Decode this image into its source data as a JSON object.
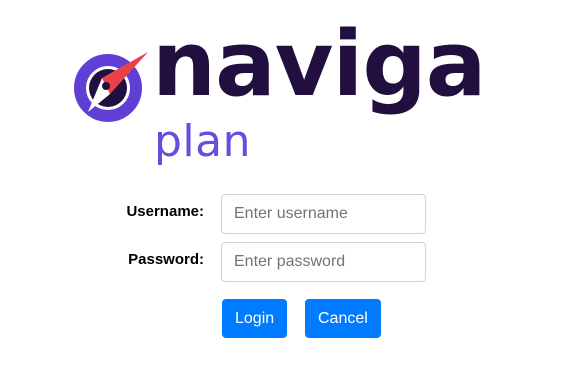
{
  "brand": {
    "name": "naviga",
    "product": "plan",
    "colors": {
      "dark": "#21103f",
      "purple": "#6a4be0",
      "red": "#e9404a",
      "ring": "#5f3fd6"
    },
    "icon": "compass-icon"
  },
  "form": {
    "username": {
      "label": "Username:",
      "placeholder": "Enter username",
      "value": ""
    },
    "password": {
      "label": "Password:",
      "placeholder": "Enter password",
      "value": ""
    }
  },
  "actions": {
    "login_label": "Login",
    "cancel_label": "Cancel",
    "button_color": "#007bff"
  }
}
